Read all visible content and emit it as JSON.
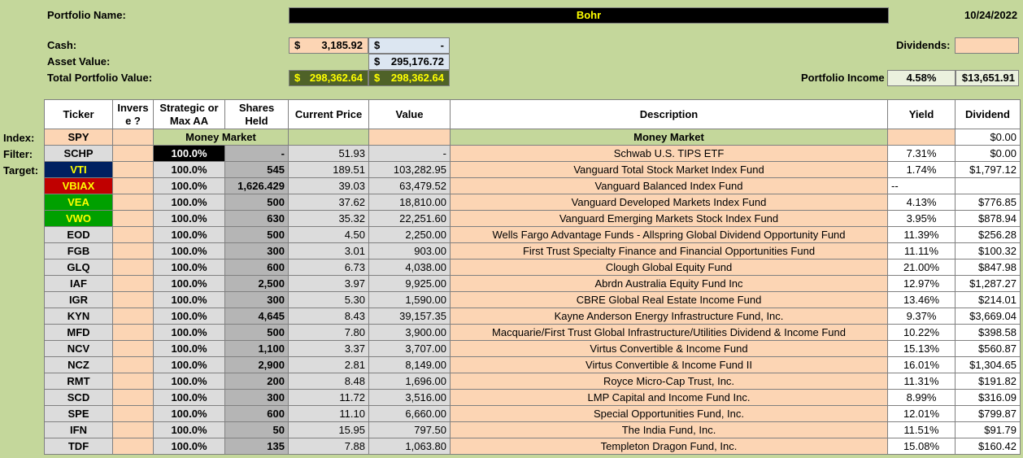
{
  "header": {
    "portfolio_name_label": "Portfolio Name:",
    "portfolio_name": "Bohr",
    "date": "10/24/2022",
    "cash_label": "Cash:",
    "cash_symbol": "$",
    "cash_value": "3,185.92",
    "cash2_symbol": "$",
    "cash2_value": "-",
    "asset_value_label": "Asset Value:",
    "asset_symbol": "$",
    "asset_value": "295,176.72",
    "total_label": "Total Portfolio Value:",
    "total_symbol": "$",
    "total_value": "298,362.64",
    "total2_symbol": "$",
    "total2_value": "298,362.64",
    "dividends_label": "Dividends:",
    "income_label": "Portfolio Income",
    "income_pct": "4.58%",
    "income_amount": "$13,651.91"
  },
  "columns": {
    "ticker": "Ticker",
    "inverse": "Invers\ne ?",
    "strategic": "Strategic or\nMax AA",
    "shares": "Shares\nHeld",
    "price": "Current Price",
    "value": "Value",
    "description": "Description",
    "yield": "Yield",
    "dividend": "Dividend"
  },
  "row_labels": {
    "index": "Index:",
    "filter": "Filter:",
    "target": "Target:"
  },
  "index_row": {
    "ticker": "SPY",
    "mm1": "Money Market",
    "mm2": "Money Market",
    "dividend": "$0.00"
  },
  "rows": [
    {
      "ticker": "SCHP",
      "aa": "100.0%",
      "shares": "-",
      "price": "51.93",
      "value": "-",
      "desc": "Schwab U.S. TIPS ETF",
      "yield": "7.31%",
      "div": "$0.00"
    },
    {
      "ticker": "VTI",
      "aa": "100.0%",
      "shares": "545",
      "price": "189.51",
      "value": "103,282.95",
      "desc": "Vanguard Total Stock Market Index Fund",
      "yield": "1.74%",
      "div": "$1,797.12"
    },
    {
      "ticker": "VBIAX",
      "aa": "100.0%",
      "shares": "1,626.429",
      "price": "39.03",
      "value": "63,479.52",
      "desc": "Vanguard Balanced Index Fund",
      "yield": "--",
      "div": ""
    },
    {
      "ticker": "VEA",
      "aa": "100.0%",
      "shares": "500",
      "price": "37.62",
      "value": "18,810.00",
      "desc": "Vanguard Developed Markets Index Fund",
      "yield": "4.13%",
      "div": "$776.85"
    },
    {
      "ticker": "VWO",
      "aa": "100.0%",
      "shares": "630",
      "price": "35.32",
      "value": "22,251.60",
      "desc": "Vanguard Emerging Markets Stock Index Fund",
      "yield": "3.95%",
      "div": "$878.94"
    },
    {
      "ticker": "EOD",
      "aa": "100.0%",
      "shares": "500",
      "price": "4.50",
      "value": "2,250.00",
      "desc": "Wells Fargo Advantage Funds - Allspring Global Dividend Opportunity Fund",
      "yield": "11.39%",
      "div": "$256.28"
    },
    {
      "ticker": "FGB",
      "aa": "100.0%",
      "shares": "300",
      "price": "3.01",
      "value": "903.00",
      "desc": "First Trust Specialty Finance and Financial Opportunities Fund",
      "yield": "11.11%",
      "div": "$100.32"
    },
    {
      "ticker": "GLQ",
      "aa": "100.0%",
      "shares": "600",
      "price": "6.73",
      "value": "4,038.00",
      "desc": "Clough Global Equity Fund",
      "yield": "21.00%",
      "div": "$847.98"
    },
    {
      "ticker": "IAF",
      "aa": "100.0%",
      "shares": "2,500",
      "price": "3.97",
      "value": "9,925.00",
      "desc": "Abrdn Australia Equity Fund Inc",
      "yield": "12.97%",
      "div": "$1,287.27"
    },
    {
      "ticker": "IGR",
      "aa": "100.0%",
      "shares": "300",
      "price": "5.30",
      "value": "1,590.00",
      "desc": "CBRE Global Real Estate Income Fund",
      "yield": "13.46%",
      "div": "$214.01"
    },
    {
      "ticker": "KYN",
      "aa": "100.0%",
      "shares": "4,645",
      "price": "8.43",
      "value": "39,157.35",
      "desc": "Kayne Anderson Energy Infrastructure Fund, Inc.",
      "yield": "9.37%",
      "div": "$3,669.04"
    },
    {
      "ticker": "MFD",
      "aa": "100.0%",
      "shares": "500",
      "price": "7.80",
      "value": "3,900.00",
      "desc": "Macquarie/First Trust Global Infrastructure/Utilities Dividend & Income Fund",
      "yield": "10.22%",
      "div": "$398.58"
    },
    {
      "ticker": "NCV",
      "aa": "100.0%",
      "shares": "1,100",
      "price": "3.37",
      "value": "3,707.00",
      "desc": "Virtus Convertible & Income Fund",
      "yield": "15.13%",
      "div": "$560.87"
    },
    {
      "ticker": "NCZ",
      "aa": "100.0%",
      "shares": "2,900",
      "price": "2.81",
      "value": "8,149.00",
      "desc": "Virtus Convertible & Income Fund II",
      "yield": "16.01%",
      "div": "$1,304.65"
    },
    {
      "ticker": "RMT",
      "aa": "100.0%",
      "shares": "200",
      "price": "8.48",
      "value": "1,696.00",
      "desc": "Royce Micro-Cap Trust, Inc.",
      "yield": "11.31%",
      "div": "$191.82"
    },
    {
      "ticker": "SCD",
      "aa": "100.0%",
      "shares": "300",
      "price": "11.72",
      "value": "3,516.00",
      "desc": "LMP Capital and Income Fund Inc.",
      "yield": "8.99%",
      "div": "$316.09"
    },
    {
      "ticker": "SPE",
      "aa": "100.0%",
      "shares": "600",
      "price": "11.10",
      "value": "6,660.00",
      "desc": "Special Opportunities Fund, Inc.",
      "yield": "12.01%",
      "div": "$799.87"
    },
    {
      "ticker": "IFN",
      "aa": "100.0%",
      "shares": "50",
      "price": "15.95",
      "value": "797.50",
      "desc": "The India Fund, Inc.",
      "yield": "11.51%",
      "div": "$91.79"
    },
    {
      "ticker": "TDF",
      "aa": "100.0%",
      "shares": "135",
      "price": "7.88",
      "value": "1,063.80",
      "desc": "Templeton Dragon Fund, Inc.",
      "yield": "15.08%",
      "div": "$160.42"
    }
  ],
  "ticker_colors": {
    "VTI": {
      "bg": "#002060",
      "fg": "#ffff00"
    },
    "VBIAX": {
      "bg": "#c00000",
      "fg": "#ffff00"
    },
    "VEA": {
      "bg": "#00a000",
      "fg": "#ffff00"
    },
    "VWO": {
      "bg": "#00a000",
      "fg": "#ffff00"
    }
  }
}
